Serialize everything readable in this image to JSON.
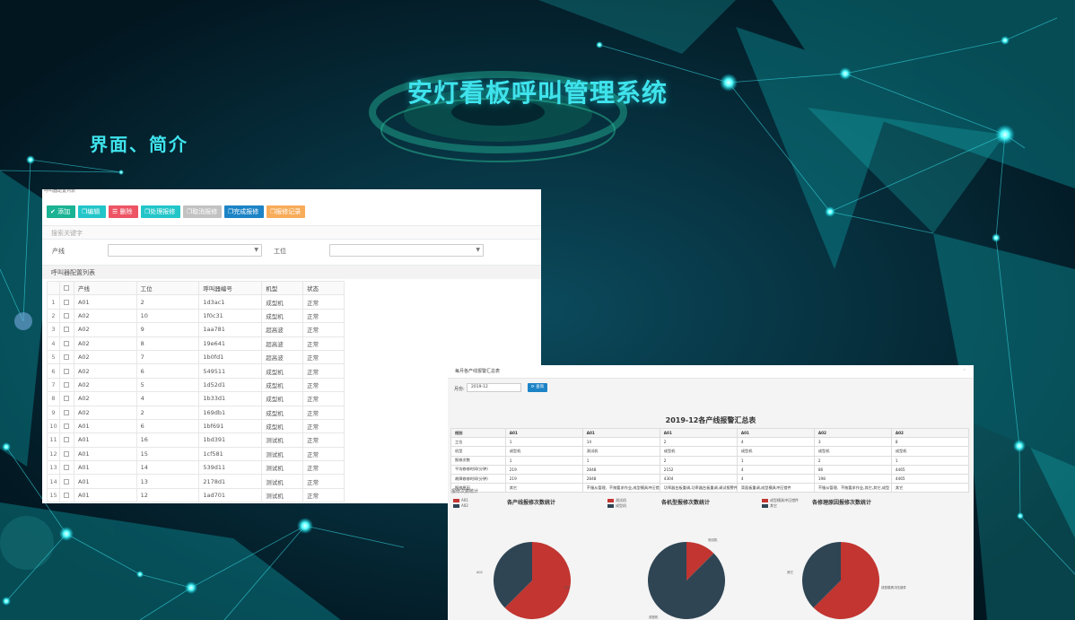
{
  "header": {
    "title": "安灯看板呼叫管理系统",
    "subtitle": "界面、简介"
  },
  "list_window": {
    "caption": "呼叫器配置列表",
    "toolbar": [
      {
        "label": "添加",
        "icon": "check-icon"
      },
      {
        "label": "编辑",
        "icon": "copy-icon"
      },
      {
        "label": "删除",
        "icon": "list-icon"
      },
      {
        "label": "处理报修",
        "icon": "copy-icon"
      },
      {
        "label": "取消报修",
        "icon": "copy-icon"
      },
      {
        "label": "完成报修",
        "icon": "copy-icon"
      },
      {
        "label": "报修记录",
        "icon": "copy-icon"
      }
    ],
    "search_label": "搜索关键字",
    "filter_line_label": "产线",
    "filter_station_label": "工位",
    "list_title": "呼叫器配置列表",
    "columns": [
      "产线",
      "工位",
      "呼叫器编号",
      "机型",
      "状态"
    ],
    "rows": [
      [
        "1",
        "A01",
        "2",
        "1d3ac1",
        "成型机",
        "正常"
      ],
      [
        "2",
        "A02",
        "10",
        "1f0c31",
        "成型机",
        "正常"
      ],
      [
        "3",
        "A02",
        "9",
        "1aa781",
        "超高波",
        "正常"
      ],
      [
        "4",
        "A02",
        "8",
        "19e641",
        "超高波",
        "正常"
      ],
      [
        "5",
        "A02",
        "7",
        "1b0fd1",
        "超高波",
        "正常"
      ],
      [
        "6",
        "A02",
        "6",
        "549511",
        "成型机",
        "正常"
      ],
      [
        "7",
        "A02",
        "5",
        "1d52d1",
        "成型机",
        "正常"
      ],
      [
        "8",
        "A02",
        "4",
        "1b33d1",
        "成型机",
        "正常"
      ],
      [
        "9",
        "A02",
        "2",
        "169db1",
        "成型机",
        "正常"
      ],
      [
        "10",
        "A01",
        "6",
        "1bf691",
        "成型机",
        "正常"
      ],
      [
        "11",
        "A01",
        "16",
        "1bd391",
        "测试机",
        "正常"
      ],
      [
        "12",
        "A01",
        "15",
        "1cf581",
        "测试机",
        "正常"
      ],
      [
        "13",
        "A01",
        "14",
        "539d11",
        "测试机",
        "正常"
      ],
      [
        "14",
        "A01",
        "13",
        "2178d1",
        "测试机",
        "正常"
      ],
      [
        "15",
        "A01",
        "12",
        "1ad701",
        "测试机",
        "正常"
      ]
    ]
  },
  "report_window": {
    "caption": "每月各产线报警汇总表",
    "month_label": "月份:",
    "month_value": "2019-12",
    "query_label": "查询",
    "report_title": "2019-12各产线报警汇总表",
    "table": [
      [
        "线别",
        "A01",
        "A01",
        "A01",
        "A01",
        "A02",
        "A02"
      ],
      [
        "工位",
        "1",
        "14",
        "2",
        "4",
        "3",
        "8"
      ],
      [
        "机型",
        "成型机",
        "测试机",
        "成型机",
        "成型机",
        "成型机",
        "成型机"
      ],
      [
        "报修次数",
        "1",
        "1",
        "2",
        "1",
        "2",
        "1"
      ],
      [
        "平均修修时间(分钟)",
        "219",
        "2848",
        "2152",
        "4",
        "86",
        "4465"
      ],
      [
        "故障修修时间(分钟)",
        "219",
        "2848",
        "4304",
        "4",
        "198",
        "4465"
      ],
      [
        "报修原因",
        "其它",
        "不服从管理、不按要求作业,成型模具冲压错",
        "功率器台板重调,功率器台板重调,调试报警件",
        "背面板重调,成型模具冲压错件",
        "不服从管理、不按要求作业,其它,其它,成型",
        "其它"
      ]
    ],
    "count_title": "报修次数统计",
    "charts": [
      {
        "title": "各产线报修次数统计",
        "legend": [
          {
            "label": "A01",
            "color": "#c23531"
          },
          {
            "label": "A02",
            "color": "#2f4554"
          }
        ],
        "slice_labels": [
          "A01",
          "A02"
        ]
      },
      {
        "title": "各机型报修次数统计",
        "legend": [
          {
            "label": "测试机",
            "color": "#c23531"
          },
          {
            "label": "成型机",
            "color": "#2f4554"
          }
        ],
        "slice_labels": [
          "测试机",
          "成型机"
        ]
      },
      {
        "title": "各修理原因报修次数统计",
        "legend": [
          {
            "label": "成型模具冲压错件",
            "color": "#c23531"
          },
          {
            "label": "其它",
            "color": "#2f4554"
          }
        ],
        "slice_labels": [
          "成型模具冲压错件",
          "其它"
        ]
      }
    ]
  },
  "chart_data": [
    {
      "type": "pie",
      "title": "各产线报修次数统计",
      "categories": [
        "A01",
        "A02"
      ],
      "values": [
        5,
        3
      ]
    },
    {
      "type": "pie",
      "title": "各机型报修次数统计",
      "categories": [
        "测试机",
        "成型机"
      ],
      "values": [
        1,
        7
      ]
    },
    {
      "type": "pie",
      "title": "各修理原因报修次数统计",
      "categories": [
        "成型模具冲压错件",
        "其它"
      ],
      "values": [
        5,
        3
      ]
    }
  ]
}
